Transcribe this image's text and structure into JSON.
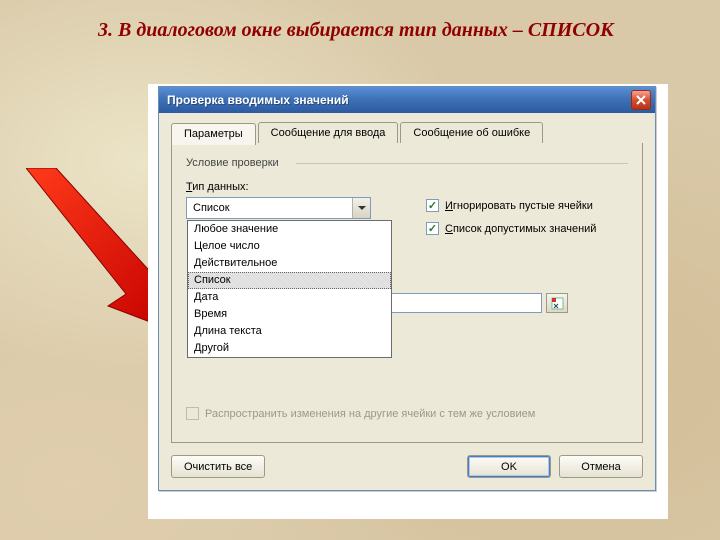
{
  "caption": "3. В диалоговом окне выбирается тип данных – СПИСОК",
  "dialog": {
    "title": "Проверка вводимых значений",
    "tabs": [
      "Параметры",
      "Сообщение для ввода",
      "Сообщение об ошибке"
    ],
    "active_tab": 0,
    "group_label": "Условие проверки",
    "type_label": "Тип данных:",
    "type_label_u": "Т",
    "type_value": "Список",
    "type_options": [
      "Любое значение",
      "Целое число",
      "Действительное",
      "Список",
      "Дата",
      "Время",
      "Длина текста",
      "Другой"
    ],
    "type_selected_index": 3,
    "checkbox_ignore": "Игнорировать пустые ячейки",
    "checkbox_ignore_u": "И",
    "checkbox_ignore_checked": true,
    "checkbox_list": "Список допустимых значений",
    "checkbox_list_u": "С",
    "checkbox_list_checked": true,
    "checkbox_propagate": "Распространить изменения на другие ячейки с тем же условием",
    "checkbox_propagate_checked": false,
    "checkbox_propagate_enabled": false,
    "buttons": {
      "clear": "Очистить все",
      "ok": "OK",
      "cancel": "Отмена"
    }
  }
}
